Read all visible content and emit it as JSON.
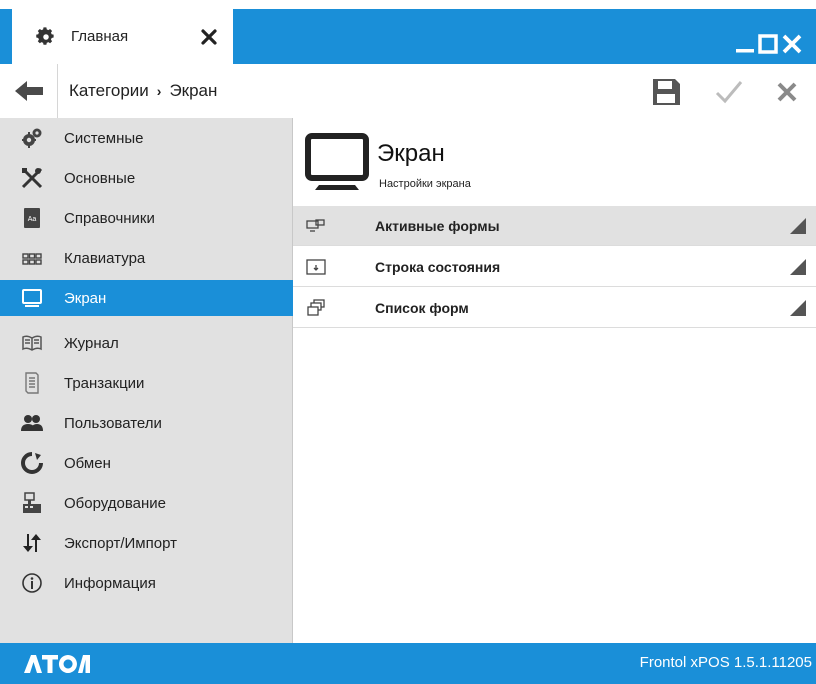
{
  "window": {
    "tab_label": "Главная",
    "tab_icon": "gear-icon",
    "controls": [
      "minimize-icon",
      "maximize-icon",
      "close-icon"
    ]
  },
  "breadcrumb": {
    "items": [
      "Категории",
      "Экран"
    ],
    "separator": "›"
  },
  "toolbar": {
    "save_icon": "floppy-disk-icon",
    "apply_icon": "checkmark-icon",
    "cancel_icon": "close-x-icon"
  },
  "sidebar": {
    "items": [
      {
        "label": "Системные",
        "icon": "gears-icon"
      },
      {
        "label": "Основные",
        "icon": "tools-icon"
      },
      {
        "label": "Справочники",
        "icon": "book-icon"
      },
      {
        "label": "Клавиатура",
        "icon": "keyboard-icon"
      },
      {
        "label": "Экран",
        "icon": "monitor-icon",
        "active": true
      },
      {
        "label": "Журнал",
        "icon": "open-book-icon"
      },
      {
        "label": "Транзакции",
        "icon": "receipt-icon"
      },
      {
        "label": "Пользователи",
        "icon": "users-icon"
      },
      {
        "label": "Обмен",
        "icon": "refresh-icon"
      },
      {
        "label": "Оборудование",
        "icon": "cash-register-icon"
      },
      {
        "label": "Экспорт/Импорт",
        "icon": "arrows-icon"
      },
      {
        "label": "Информация",
        "icon": "info-icon"
      }
    ]
  },
  "content": {
    "title": "Экран",
    "subtitle": "Настройки экрана",
    "rows": [
      {
        "label": "Активные формы",
        "icon": "active-forms-icon"
      },
      {
        "label": "Строка состояния",
        "icon": "status-bar-icon"
      },
      {
        "label": "Список форм",
        "icon": "forms-list-icon"
      }
    ]
  },
  "footer": {
    "logo": "АТОЛ",
    "version": "Frontol xPOS 1.5.1.11205"
  },
  "colors": {
    "accent": "#1a8fd8",
    "sidebar_bg": "#e1e1e1"
  }
}
